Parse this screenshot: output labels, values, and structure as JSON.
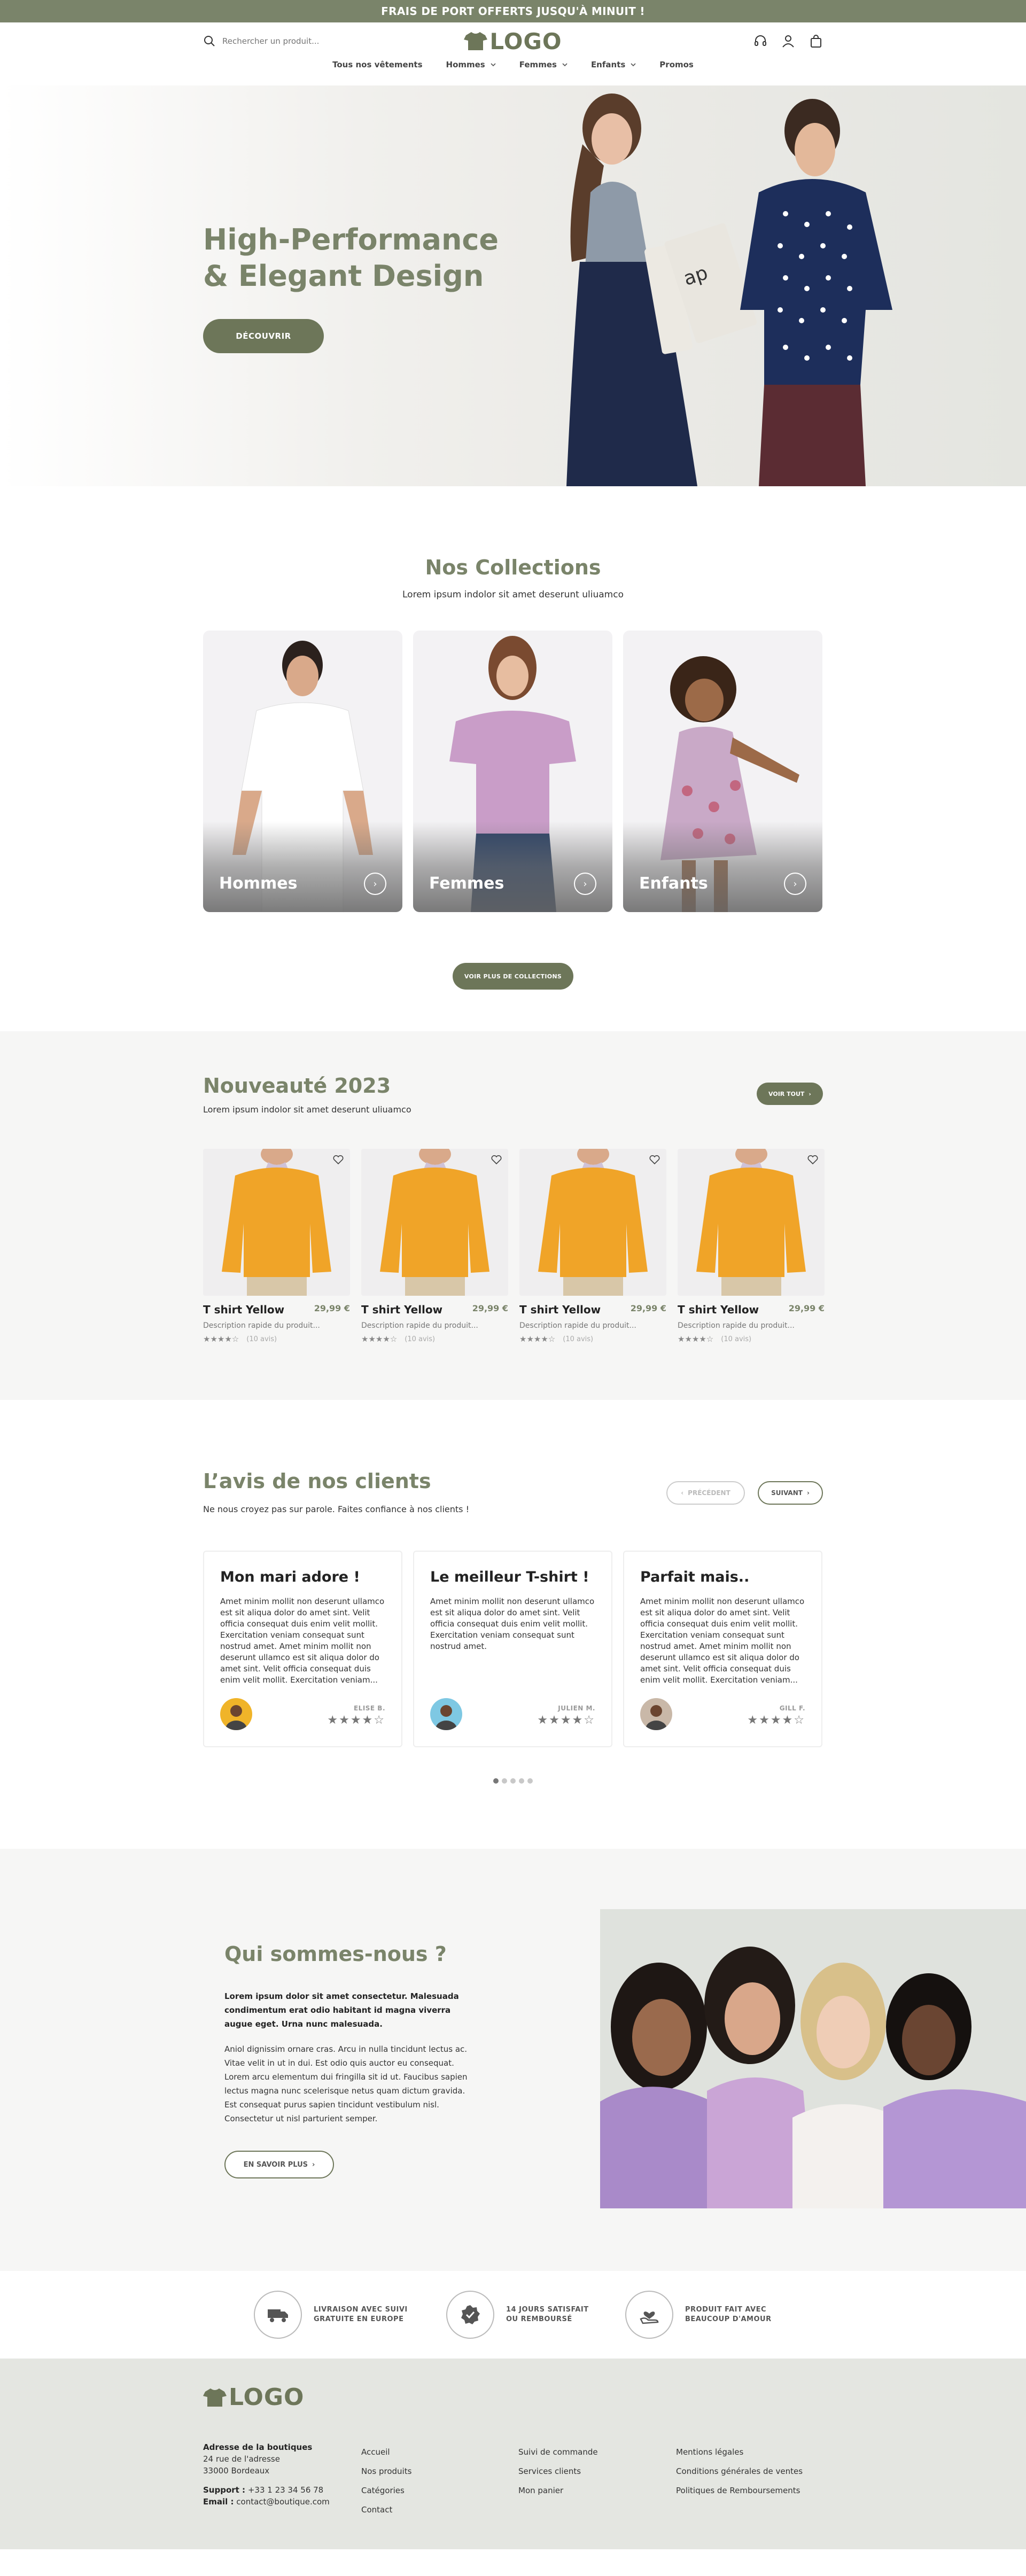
{
  "topbar": {
    "text": "FRAIS DE PORT OFFERTS JUSQU'À MINUIT !"
  },
  "header": {
    "search_placeholder": "Rechercher un produit...",
    "logo_text": "LOGO",
    "nav": [
      {
        "label": "Tous nos vêtements",
        "has_dropdown": false
      },
      {
        "label": "Hommes",
        "has_dropdown": true
      },
      {
        "label": "Femmes",
        "has_dropdown": true
      },
      {
        "label": "Enfants",
        "has_dropdown": true
      },
      {
        "label": "Promos",
        "has_dropdown": false
      }
    ],
    "icons": [
      "headset-icon",
      "user-icon",
      "bag-icon"
    ]
  },
  "hero": {
    "title_line1": "High-Performance",
    "title_line2": "& Elegant Design",
    "cta": "DÉCOUVRIR"
  },
  "collections": {
    "title": "Nos Collections",
    "subtitle": "Lorem ipsum indolor sit amet deserunt uliuamco",
    "cards": [
      {
        "label": "Hommes"
      },
      {
        "label": "Femmes"
      },
      {
        "label": "Enfants"
      }
    ],
    "more_button": "VOIR PLUS DE COLLECTIONS"
  },
  "news": {
    "title": "Nouveauté 2023",
    "subtitle": "Lorem ipsum indolor sit amet deserunt uliuamco",
    "see_all": "VOIR TOUT",
    "products": [
      {
        "name": "T shirt Yellow",
        "price": "29,99 €",
        "description": "Description rapide du produit...",
        "rating": 4,
        "reviews": "(10 avis)"
      },
      {
        "name": "T shirt Yellow",
        "price": "29,99 €",
        "description": "Description rapide du produit...",
        "rating": 4,
        "reviews": "(10 avis)"
      },
      {
        "name": "T shirt Yellow",
        "price": "29,99 €",
        "description": "Description rapide du produit...",
        "rating": 4,
        "reviews": "(10 avis)"
      },
      {
        "name": "T shirt Yellow",
        "price": "29,99 €",
        "description": "Description rapide du produit...",
        "rating": 4,
        "reviews": "(10 avis)"
      }
    ]
  },
  "reviews": {
    "title": "L’avis de nos clients",
    "subtitle": "Ne nous croyez pas sur parole. Faites confiance à nos clients !",
    "prev": "PRÉCÉDENT",
    "next": "SUIVANT",
    "items": [
      {
        "title": "Mon mari adore !",
        "text": "Amet minim mollit non deserunt ullamco est sit aliqua dolor do amet sint. Velit officia consequat duis enim velit mollit. Exercitation veniam consequat sunt nostrud amet. Amet minim mollit non deserunt ullamco est sit aliqua dolor do amet sint. Velit officia consequat duis enim velit mollit. Exercitation veniam...",
        "author": "ELISE B.",
        "rating": 4,
        "avatar_bg": "#f0b429"
      },
      {
        "title": "Le meilleur T-shirt !",
        "text": "Amet minim mollit non deserunt ullamco est sit aliqua dolor do amet sint. Velit officia consequat duis enim velit mollit. Exercitation veniam consequat sunt nostrud amet.",
        "author": "JULIEN M.",
        "rating": 4,
        "avatar_bg": "#7ec8e3"
      },
      {
        "title": "Parfait mais..",
        "text": "Amet minim mollit non deserunt ullamco est sit aliqua dolor do amet sint. Velit officia consequat duis enim velit mollit. Exercitation veniam consequat sunt nostrud amet. Amet minim mollit non deserunt ullamco est sit aliqua dolor do amet sint. Velit officia consequat duis enim velit mollit. Exercitation veniam...",
        "author": "GILL F.",
        "rating": 4,
        "avatar_bg": "#c9b8a8"
      }
    ],
    "dots": 5,
    "active_dot": 0
  },
  "about": {
    "title": "Qui sommes-nous ?",
    "lead": "Lorem ipsum dolor sit amet consectetur. Malesuada condimentum erat odio habitant id magna viverra augue eget. Urna nunc malesuada.",
    "body": "Aniol dignissim ornare cras. Arcu in nulla tincidunt lectus ac. Vitae velit in ut in dui. Est odio quis auctor eu consequat. Lorem arcu elementum dui fringilla sit id ut. Faucibus sapien lectus magna nunc scelerisque netus quam dictum gravida. Est consequat purus sapien tincidunt vestibulum nisl. Consectetur ut nisl parturient semper.",
    "cta": "EN SAVOIR PLUS"
  },
  "features": [
    {
      "line1": "LIVRAISON AVEC SUIVI",
      "line2": "GRATUITE EN EUROPE",
      "icon": "truck-icon"
    },
    {
      "line1": "14 JOURS SATISFAIT",
      "line2": "OU REMBOURSÉ",
      "icon": "badge-check-icon"
    },
    {
      "line1": "PRODUIT FAIT AVEC",
      "line2": "BEAUCOUP D'AMOUR",
      "icon": "heart-hand-icon"
    }
  ],
  "footer": {
    "logo_text": "LOGO",
    "address_title": "Adresse de la boutiques",
    "address_line1": "24 rue de l'adresse",
    "address_line2": "33000 Bordeaux",
    "support_label": "Support :",
    "support_value": "+33 1 23 34 56 78",
    "email_label": "Email :",
    "email_value": "contact@boutique.com",
    "col2": [
      "Accueil",
      "Nos produits",
      "Catégories",
      "Contact"
    ],
    "col3": [
      "Suivi de commande",
      "Services clients",
      "Mon panier"
    ],
    "col4": [
      "Mentions légales",
      "Conditions générales de ventes",
      "Politiques de Remboursements"
    ]
  },
  "colors": {
    "brand": "#7a846a",
    "brand_dark": "#6d7659",
    "light_bg": "#f6f6f5",
    "footer_bg": "#e4e6e1"
  }
}
